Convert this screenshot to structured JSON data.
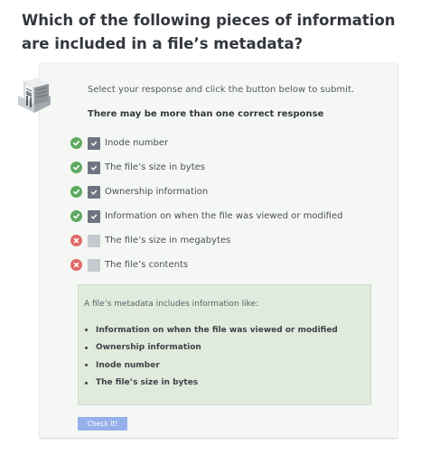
{
  "question": {
    "title": "Which of the following pieces of information are included in a file’s metadata?"
  },
  "quiz": {
    "icon": "server-rack-icon",
    "instruction": "Select your response and click the button below to submit.",
    "hint": "There may be more than one correct response",
    "options": [
      {
        "label": "Inode number",
        "checked": true,
        "result": "correct"
      },
      {
        "label": "The file’s size in bytes",
        "checked": true,
        "result": "correct"
      },
      {
        "label": "Ownership information",
        "checked": true,
        "result": "correct"
      },
      {
        "label": "Information on when the file was viewed or modified",
        "checked": true,
        "result": "correct"
      },
      {
        "label": "The file’s size in megabytes",
        "checked": false,
        "result": "incorrect"
      },
      {
        "label": "The file’s contents",
        "checked": false,
        "result": "incorrect"
      }
    ],
    "feedback": {
      "intro": "A file’s metadata includes information like:",
      "items": [
        "Information on when the file was viewed or modified",
        "Ownership information",
        "Inode number",
        "The file’s size in bytes"
      ]
    },
    "submit_label": "Check It!"
  },
  "colors": {
    "correct": "#5eaa62",
    "incorrect": "#e06a6a",
    "checkbox_checked": "#6f7480",
    "checkbox_unchecked": "#c6c9cd",
    "button": "#95b0ea",
    "card_background": "#f4f7f3",
    "feedback_background": "#e0ebdd"
  }
}
